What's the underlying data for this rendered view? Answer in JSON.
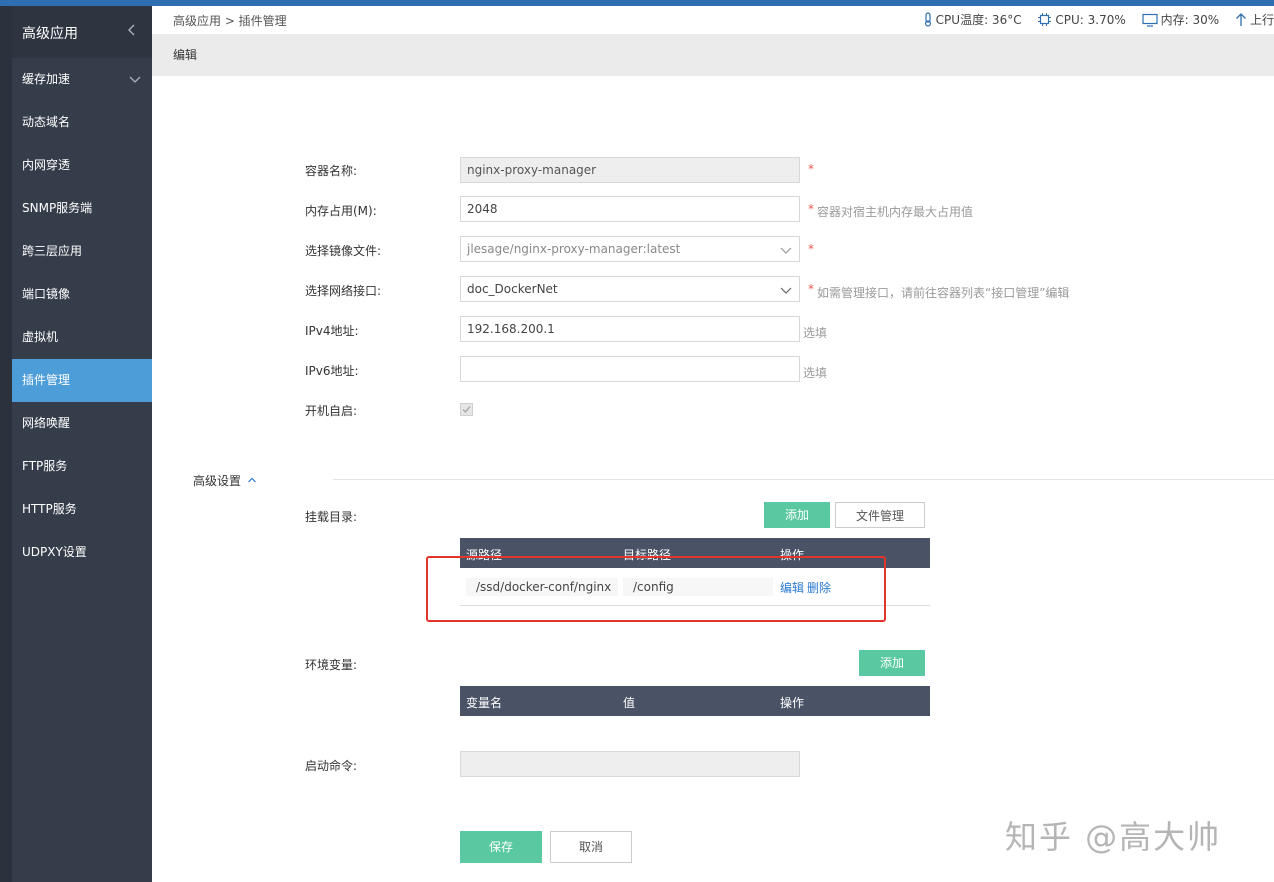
{
  "sidebar": {
    "title": "高级应用",
    "items": [
      {
        "label": "缓存加速"
      },
      {
        "label": "动态域名"
      },
      {
        "label": "内网穿透"
      },
      {
        "label": "SNMP服务端"
      },
      {
        "label": "跨三层应用"
      },
      {
        "label": "端口镜像"
      },
      {
        "label": "虚拟机"
      },
      {
        "label": "插件管理",
        "active": true
      },
      {
        "label": "网络唤醒"
      },
      {
        "label": "FTP服务"
      },
      {
        "label": "HTTP服务"
      },
      {
        "label": "UDPXY设置"
      }
    ],
    "active_color": "#4d9dd9"
  },
  "topbar": {
    "breadcrumb": "高级应用 > 插件管理",
    "cpu_temp": "CPU温度: 36°C",
    "cpu": "CPU: 3.70%",
    "memory": "内存: 30%",
    "upload": "上行"
  },
  "subheader": {
    "title": "编辑"
  },
  "form": {
    "container_name": {
      "label": "容器名称:",
      "value": "nginx-proxy-manager",
      "required": "*"
    },
    "memory": {
      "label": "内存占用(M):",
      "value": "2048",
      "required": "*",
      "hint": "容器对宿主机内存最大占用值"
    },
    "image": {
      "label": "选择镜像文件:",
      "value": "jlesage/nginx-proxy-manager:latest",
      "required": "*"
    },
    "network": {
      "label": "选择网络接口:",
      "value": "doc_DockerNet",
      "required": "*",
      "hint": "如需管理接口，请前往容器列表“接口管理”编辑"
    },
    "ipv4": {
      "label": "IPv4地址:",
      "value": "192.168.200.1",
      "hint": "选填"
    },
    "ipv6": {
      "label": "IPv6地址:",
      "value": "",
      "hint": "选填"
    },
    "autostart": {
      "label": "开机自启:"
    }
  },
  "advanced": {
    "label": "高级设置",
    "mounts": {
      "label": "挂载目录:",
      "add_label": "添加",
      "file_mgmt_label": "文件管理",
      "columns": [
        "源路径",
        "目标路径",
        "操作"
      ],
      "rows": [
        {
          "source": "/ssd/docker-conf/nginx",
          "target": "/config",
          "edit": "编辑",
          "delete": "删除"
        }
      ]
    },
    "env": {
      "label": "环境变量:",
      "add_label": "添加",
      "columns": [
        "变量名",
        "值",
        "操作"
      ]
    },
    "command": {
      "label": "启动命令:",
      "value": ""
    }
  },
  "actions": {
    "save": "保存",
    "cancel": "取消"
  },
  "watermark": "知乎 @高大帅",
  "colors": {
    "green": "#5ac8a1",
    "header": "#4a5366",
    "sidebar": "#353d4b",
    "highlight": "#e0352b"
  }
}
